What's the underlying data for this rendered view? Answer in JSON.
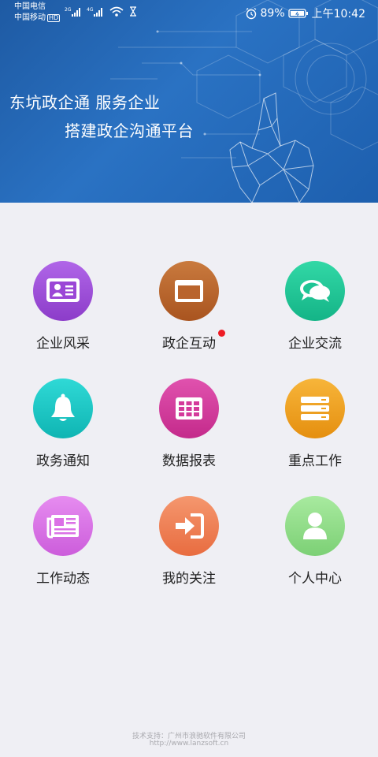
{
  "status": {
    "carrier1": "中国电信",
    "carrier2": "中国移动",
    "hd": "HD",
    "net1": "2G",
    "net2": "4G",
    "battery": "89%",
    "time": "上午10:42"
  },
  "banner": {
    "line1": "东坑政企通  服务企业",
    "line2": "搭建政企沟通平台"
  },
  "menu": [
    {
      "label": "企业风采",
      "icon": "id-card-icon",
      "color": "#9b46d6"
    },
    {
      "label": "政企互动",
      "icon": "window-icon",
      "color": "#b9642d",
      "badge": true
    },
    {
      "label": "企业交流",
      "icon": "chat-bubbles-icon",
      "color": "#1fc595"
    },
    {
      "label": "政务通知",
      "icon": "bell-icon",
      "color": "#17c7c4"
    },
    {
      "label": "数据报表",
      "icon": "table-icon",
      "color": "#d43a9b"
    },
    {
      "label": "重点工作",
      "icon": "stack-icon",
      "color": "#f0a21c"
    },
    {
      "label": "工作动态",
      "icon": "newspaper-icon",
      "color": "#db71e6"
    },
    {
      "label": "我的关注",
      "icon": "sign-in-icon",
      "color": "#f08358"
    },
    {
      "label": "个人中心",
      "icon": "user-icon",
      "color": "#92e08b"
    }
  ],
  "footer": {
    "line1": "技术支持：广州市浪驰软件有限公司",
    "line2": "http://www.lanzsoft.cn"
  }
}
